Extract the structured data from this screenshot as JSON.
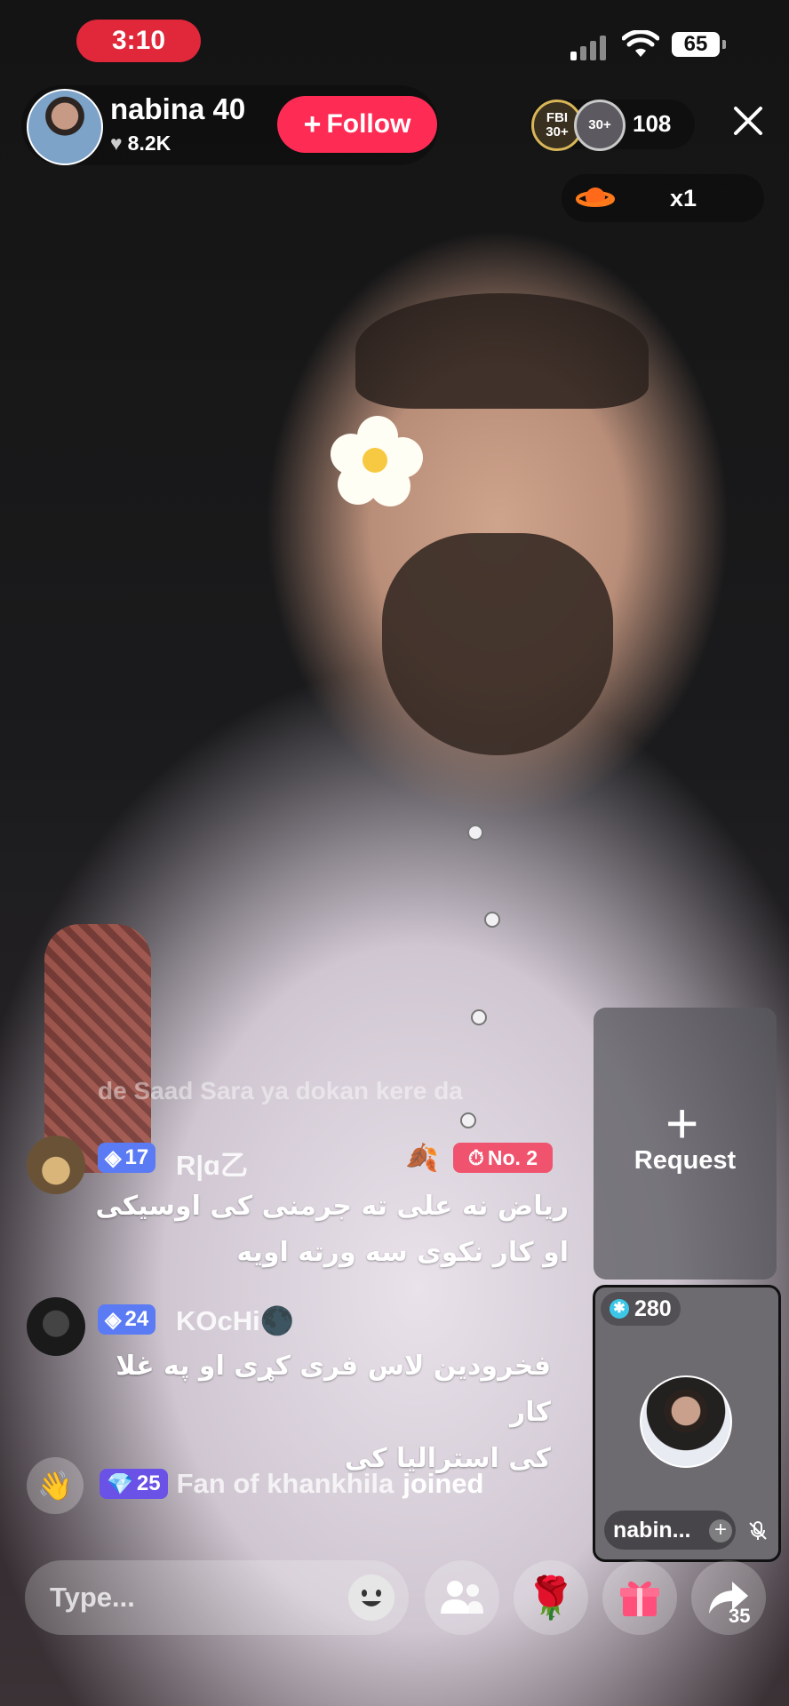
{
  "status_bar": {
    "time": "3:10",
    "battery": "65"
  },
  "host": {
    "name": "nabina 40",
    "likes": "8.2K",
    "follow_label": "Follow"
  },
  "viewers": {
    "badges": [
      {
        "top": "FBI",
        "bottom": "30+"
      },
      {
        "top": "",
        "bottom": "30+"
      }
    ],
    "count": "108"
  },
  "gift_counter": {
    "label": "x1"
  },
  "chat": {
    "faded_line": "de Saad Sara ya dokan kere da",
    "messages": [
      {
        "level": "17",
        "username": "R|ɑ乙",
        "rank": "No. 2",
        "text_line1": "ریاض نه علی ته  جرمنی کی اوسیکی",
        "text_line2": "او کار نکوی سه ورته اویه"
      },
      {
        "level": "24",
        "username": "KOcHi🌑",
        "text_line1": "فخرودین لاس فری کړی او په غلا کار",
        "text_line2": "کی استرالیا کی"
      }
    ],
    "join": {
      "level": "25",
      "user": "Fan of khankhila",
      "action": "joined"
    }
  },
  "guest_panel": {
    "request_label": "Request",
    "guest": {
      "score": "280",
      "name": "nabin..."
    }
  },
  "bottom_bar": {
    "placeholder": "Type...",
    "share_count": "35"
  },
  "colors": {
    "follow": "#fe2c55",
    "time_pill": "#e0283a",
    "level_blue": "#5b7bf5",
    "level_purple": "#6a52e6",
    "rank": "#f0536e"
  }
}
